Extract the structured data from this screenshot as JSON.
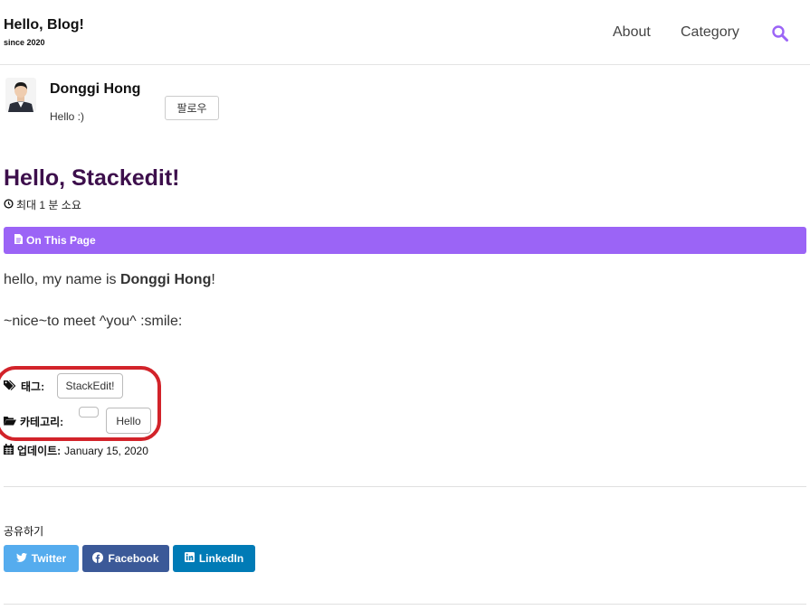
{
  "header": {
    "site_title": "Hello, Blog!",
    "site_subtitle": "since 2020",
    "nav": [
      {
        "label": "About"
      },
      {
        "label": "Category"
      }
    ],
    "search_icon": "search-icon"
  },
  "author": {
    "name": "Donggi Hong",
    "bio": "Hello :)",
    "follow_label": "팔로우"
  },
  "post": {
    "title": "Hello, Stackedit!",
    "read_time": "최대 1 분 소요",
    "toc_label": "On This Page",
    "body": {
      "p1_prefix": "hello, my name is ",
      "p1_bold": "Donggi Hong",
      "p1_suffix": "!",
      "p2": "~nice~to meet ^you^ :smile:"
    },
    "tags_label": "태그:",
    "tags": [
      "StackEdit!"
    ],
    "categories_label": "카테고리:",
    "categories": [
      "",
      "Hello"
    ],
    "updated_label": "업데이트:",
    "updated_date": "January 15, 2020"
  },
  "share": {
    "heading": "공유하기",
    "buttons": [
      {
        "label": "Twitter",
        "color": "#55acee"
      },
      {
        "label": "Facebook",
        "color": "#3b5998"
      },
      {
        "label": "LinkedIn",
        "color": "#007bb6"
      }
    ]
  },
  "colors": {
    "title": "#3d0f4c",
    "toc_bar": "#9b64f6",
    "search": "#9b64f6",
    "annotation": "#d2232a"
  }
}
